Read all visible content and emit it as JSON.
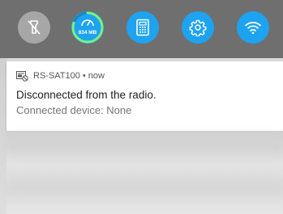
{
  "quick_settings": {
    "flashlight": {
      "icon": "flashlight-off-icon",
      "color": "#a7a7a7"
    },
    "memory": {
      "icon": "speedometer-icon",
      "label": "834 MB",
      "ring_color": "#7cf27c",
      "level": 0.8,
      "color": "#1ea3f0"
    },
    "calculator": {
      "icon": "calculator-icon",
      "color": "#1ea3f0"
    },
    "settings": {
      "icon": "gear-icon",
      "color": "#1ea3f0"
    },
    "wifi": {
      "icon": "wifi-icon",
      "color": "#1ea3f0"
    }
  },
  "notification": {
    "app_icon": "radio-app-icon",
    "app_name": "RS-SAT100",
    "separator": "•",
    "time": "now",
    "title": "Disconnected from the radio.",
    "text": "Connected device: None"
  }
}
